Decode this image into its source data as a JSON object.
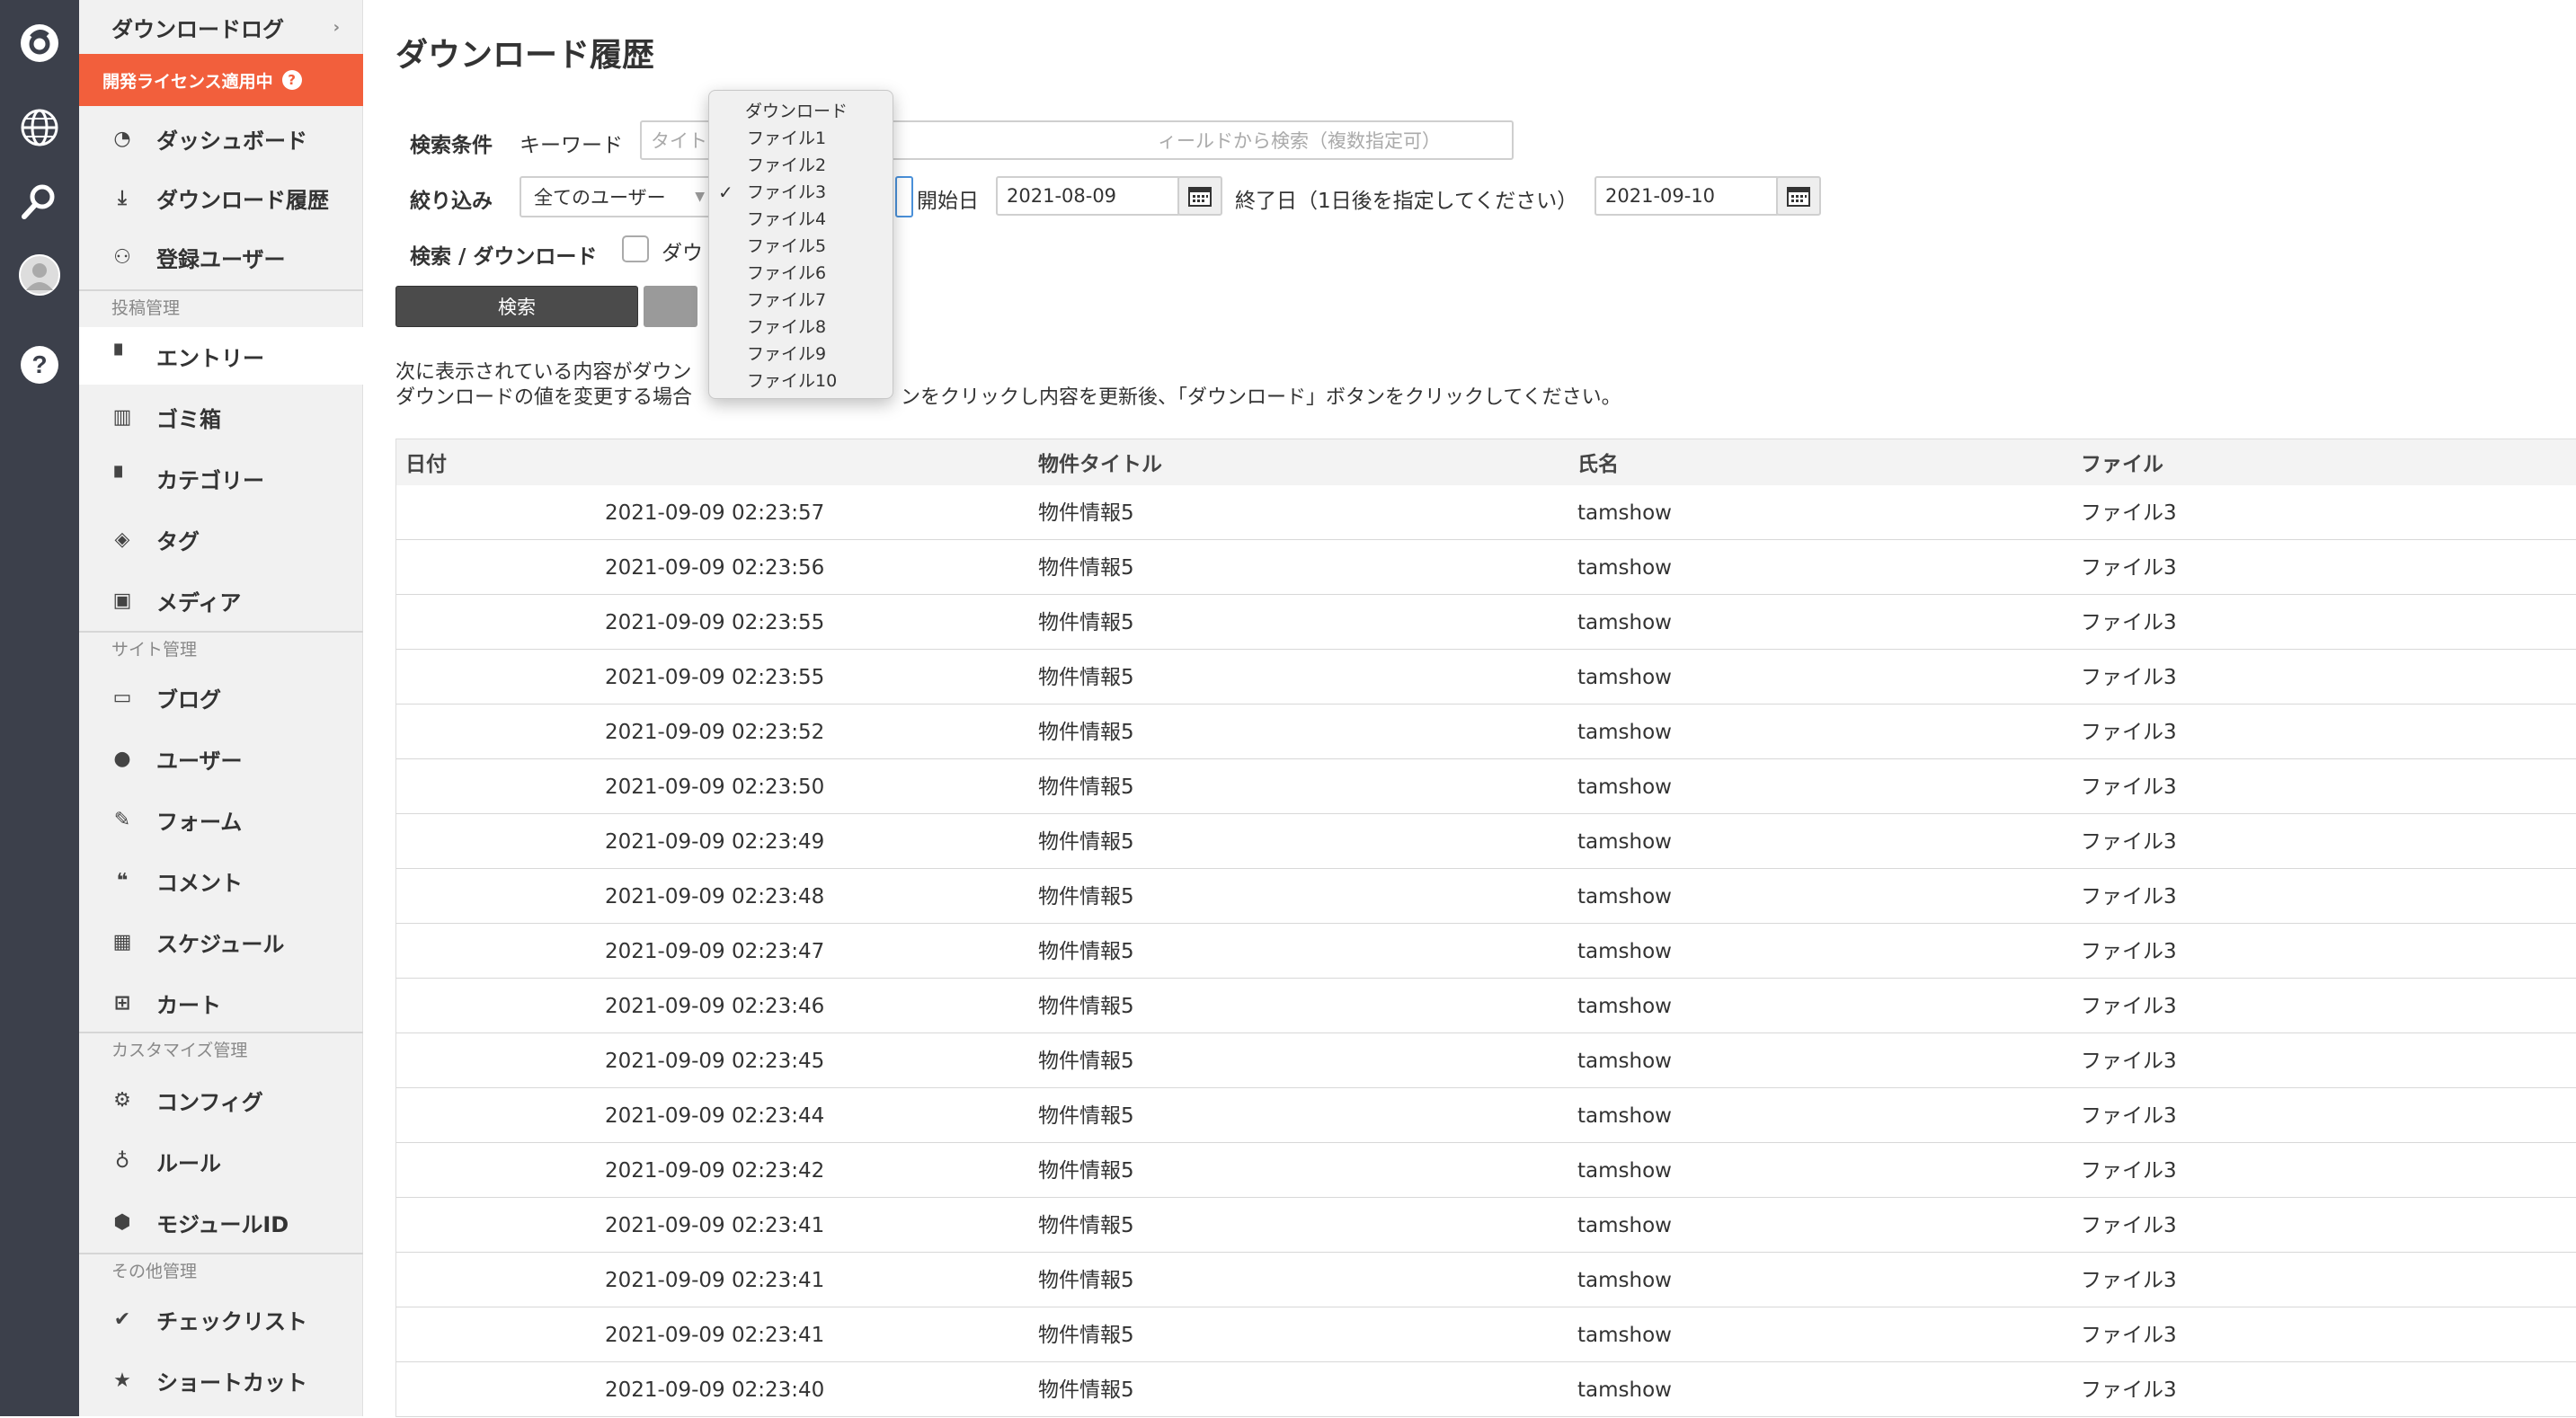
{
  "sidebar": {
    "download_log": "ダウンロードログ",
    "license_banner": "開発ライセンス適用中",
    "items_top": [
      {
        "label": "ダッシュボード",
        "icon": "dashboard-icon"
      },
      {
        "label": "ダウンロード履歴",
        "icon": "download-icon"
      },
      {
        "label": "登録ユーザー",
        "icon": "user-add-icon"
      }
    ],
    "section_posts": "投稿管理",
    "items_posts": [
      {
        "label": "エントリー",
        "icon": "entry-icon"
      },
      {
        "label": "ゴミ箱",
        "icon": "trash-icon"
      },
      {
        "label": "カテゴリー",
        "icon": "category-icon"
      },
      {
        "label": "タグ",
        "icon": "tag-icon"
      },
      {
        "label": "メディア",
        "icon": "media-icon"
      }
    ],
    "section_site": "サイト管理",
    "items_site": [
      {
        "label": "ブログ",
        "icon": "blog-icon"
      },
      {
        "label": "ユーザー",
        "icon": "user-icon"
      },
      {
        "label": "フォーム",
        "icon": "form-icon"
      },
      {
        "label": "コメント",
        "icon": "comment-icon"
      },
      {
        "label": "スケジュール",
        "icon": "calendar-icon"
      },
      {
        "label": "カート",
        "icon": "cart-icon"
      }
    ],
    "section_custom": "カスタマイズ管理",
    "items_custom": [
      {
        "label": "コンフィグ",
        "icon": "gear-icon"
      },
      {
        "label": "ルール",
        "icon": "rule-icon"
      },
      {
        "label": "モジュールID",
        "icon": "module-icon"
      }
    ],
    "section_other": "その他管理",
    "items_other": [
      {
        "label": "チェックリスト",
        "icon": "check-icon"
      },
      {
        "label": "ショートカット",
        "icon": "star-icon"
      }
    ]
  },
  "main": {
    "title": "ダウンロード履歴",
    "search_label": "検索条件",
    "keyword_label": "キーワード",
    "keyword_placeholder": "タイトルなどのフィールドから検索（複数指定可）",
    "keyword_placeholder_left": "タイト",
    "keyword_placeholder_right": "ィールドから検索（複数指定可）",
    "filter_label": "絞り込み",
    "user_select": "全てのユーザー",
    "start_label": "開始日",
    "start_date": "2021-08-09",
    "end_label": "終了日（1日後を指定してください）",
    "end_date": "2021-09-10",
    "search_download_label": "検索 / ダウンロード",
    "checkbox_label_partial": "ダウ",
    "search_button": "検索",
    "note_line1": "次に表示されている内容がダウン",
    "note_line2_left": "ダウンロードの値を変更する場合",
    "note_line2_right": "ンをクリックし内容を更新後、「ダウンロード」ボタンをクリックしてください。"
  },
  "dropdown": {
    "options": [
      "ダウンロード",
      "ファイル1",
      "ファイル2",
      "ファイル3",
      "ファイル4",
      "ファイル5",
      "ファイル6",
      "ファイル7",
      "ファイル8",
      "ファイル9",
      "ファイル10"
    ],
    "selected": "ファイル3"
  },
  "table": {
    "headers": [
      "日付",
      "物件タイトル",
      "氏名",
      "ファイル"
    ],
    "rows": [
      [
        "2021-09-09 02:23:57",
        "物件情報5",
        "tamshow",
        "ファイル3"
      ],
      [
        "2021-09-09 02:23:56",
        "物件情報5",
        "tamshow",
        "ファイル3"
      ],
      [
        "2021-09-09 02:23:55",
        "物件情報5",
        "tamshow",
        "ファイル3"
      ],
      [
        "2021-09-09 02:23:55",
        "物件情報5",
        "tamshow",
        "ファイル3"
      ],
      [
        "2021-09-09 02:23:52",
        "物件情報5",
        "tamshow",
        "ファイル3"
      ],
      [
        "2021-09-09 02:23:50",
        "物件情報5",
        "tamshow",
        "ファイル3"
      ],
      [
        "2021-09-09 02:23:49",
        "物件情報5",
        "tamshow",
        "ファイル3"
      ],
      [
        "2021-09-09 02:23:48",
        "物件情報5",
        "tamshow",
        "ファイル3"
      ],
      [
        "2021-09-09 02:23:47",
        "物件情報5",
        "tamshow",
        "ファイル3"
      ],
      [
        "2021-09-09 02:23:46",
        "物件情報5",
        "tamshow",
        "ファイル3"
      ],
      [
        "2021-09-09 02:23:45",
        "物件情報5",
        "tamshow",
        "ファイル3"
      ],
      [
        "2021-09-09 02:23:44",
        "物件情報5",
        "tamshow",
        "ファイル3"
      ],
      [
        "2021-09-09 02:23:42",
        "物件情報5",
        "tamshow",
        "ファイル3"
      ],
      [
        "2021-09-09 02:23:41",
        "物件情報5",
        "tamshow",
        "ファイル3"
      ],
      [
        "2021-09-09 02:23:41",
        "物件情報5",
        "tamshow",
        "ファイル3"
      ],
      [
        "2021-09-09 02:23:41",
        "物件情報5",
        "tamshow",
        "ファイル3"
      ],
      [
        "2021-09-09 02:23:40",
        "物件情報5",
        "tamshow",
        "ファイル3"
      ]
    ]
  },
  "colors": {
    "rail": "#3c404b",
    "license": "#f25f3c",
    "sidebar": "#f1f1f1"
  }
}
